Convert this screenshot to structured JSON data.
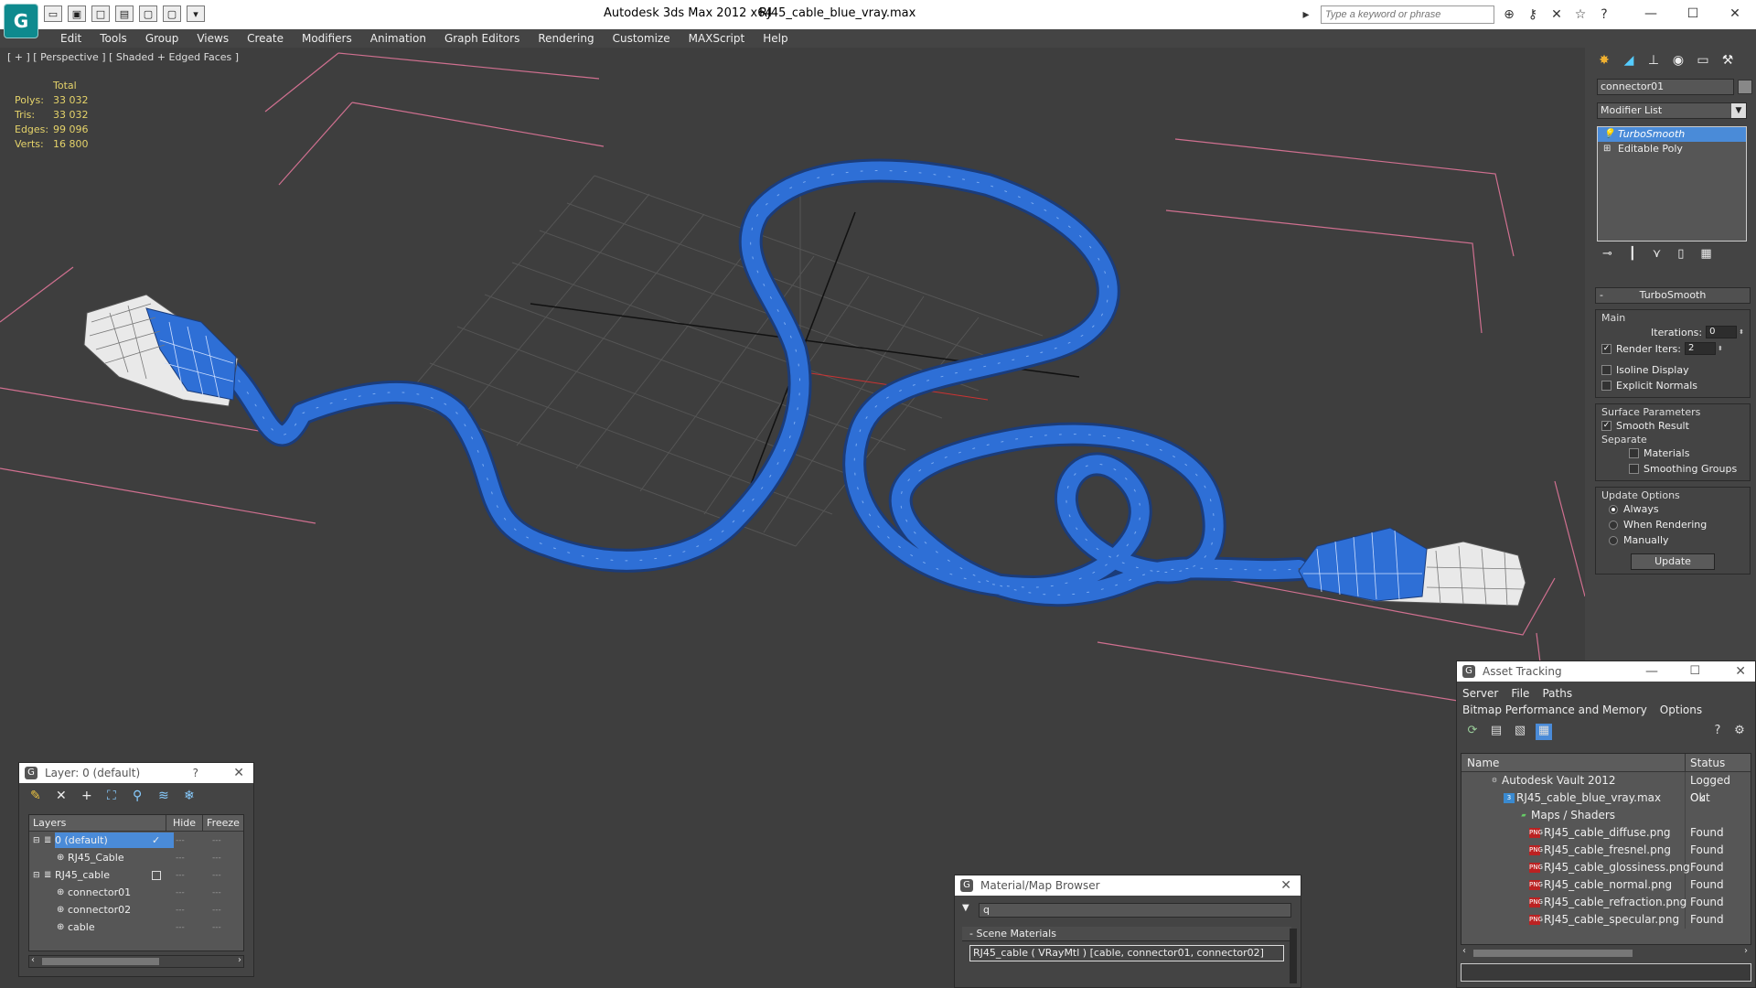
{
  "titlebar": {
    "app_title": "Autodesk 3ds Max  2012 x64",
    "file_name": "RJ45_cable_blue_vray.max",
    "search_placeholder": "Type a keyword or phrase"
  },
  "menu": [
    "Edit",
    "Tools",
    "Group",
    "Views",
    "Create",
    "Modifiers",
    "Animation",
    "Graph Editors",
    "Rendering",
    "Customize",
    "MAXScript",
    "Help"
  ],
  "viewport": {
    "label": "[ + ] [ Perspective ] [ Shaded + Edged Faces ]",
    "stats": {
      "header": "Total",
      "rows": [
        {
          "k": "Polys:",
          "v": "33 032"
        },
        {
          "k": "Tris:",
          "v": "33 032"
        },
        {
          "k": "Edges:",
          "v": "99 096"
        },
        {
          "k": "Verts:",
          "v": "16 800"
        }
      ]
    },
    "cable_color": "#2e6fd6"
  },
  "command_panel": {
    "object_name": "connector01",
    "modifier_list_label": "Modifier List",
    "stack": [
      {
        "label": "TurboSmooth",
        "selected": true
      },
      {
        "label": "Editable Poly",
        "selected": false
      }
    ],
    "rollout_title": "TurboSmooth",
    "main_group": "Main",
    "iterations_label": "Iterations:",
    "iterations_value": "0",
    "render_iters_label": "Render Iters:",
    "render_iters_value": "2",
    "isoline_label": "Isoline Display",
    "explicit_normals_label": "Explicit Normals",
    "surface_group": "Surface Parameters",
    "smooth_result_label": "Smooth Result",
    "separate_label": "Separate",
    "materials_label": "Materials",
    "smoothing_groups_label": "Smoothing Groups",
    "update_group": "Update Options",
    "always_label": "Always",
    "when_rendering_label": "When Rendering",
    "manually_label": "Manually",
    "update_button": "Update"
  },
  "layer_window": {
    "title": "Layer: 0 (default)",
    "help": "?",
    "col_layers": "Layers",
    "col_hide": "Hide",
    "col_freeze": "Freeze",
    "rows": [
      {
        "label": "0 (default)",
        "indent": 0,
        "selected": true
      },
      {
        "label": "RJ45_Cable",
        "indent": 1,
        "selected": false
      },
      {
        "label": "RJ45_cable",
        "indent": 0,
        "selected": false
      },
      {
        "label": "connector01",
        "indent": 1,
        "selected": false
      },
      {
        "label": "connector02",
        "indent": 1,
        "selected": false
      },
      {
        "label": "cable",
        "indent": 1,
        "selected": false
      }
    ]
  },
  "material_browser": {
    "title": "Material/Map Browser",
    "search_value": "q",
    "group_label": "Scene Materials",
    "item": "RJ45_cable  ( VRayMtl )  [cable, connector01, connector02]"
  },
  "asset_tracking": {
    "title": "Asset Tracking",
    "menu1": [
      "Server",
      "File",
      "Paths"
    ],
    "menu2": [
      "Bitmap Performance and Memory",
      "Options"
    ],
    "col_name": "Name",
    "col_status": "Status",
    "rows": [
      {
        "name": "Autodesk Vault 2012",
        "status": "Logged Out",
        "indent": 30,
        "icon": "vault"
      },
      {
        "name": "RJ45_cable_blue_vray.max",
        "status": "Ok",
        "indent": 46,
        "icon": "max"
      },
      {
        "name": "Maps / Shaders",
        "status": "",
        "indent": 62,
        "icon": "folder"
      },
      {
        "name": "RJ45_cable_diffuse.png",
        "status": "Found",
        "indent": 74,
        "icon": "png"
      },
      {
        "name": "RJ45_cable_fresnel.png",
        "status": "Found",
        "indent": 74,
        "icon": "png"
      },
      {
        "name": "RJ45_cable_glossiness.png",
        "status": "Found",
        "indent": 74,
        "icon": "png"
      },
      {
        "name": "RJ45_cable_normal.png",
        "status": "Found",
        "indent": 74,
        "icon": "png"
      },
      {
        "name": "RJ45_cable_refraction.png",
        "status": "Found",
        "indent": 74,
        "icon": "png"
      },
      {
        "name": "RJ45_cable_specular.png",
        "status": "Found",
        "indent": 74,
        "icon": "png"
      }
    ]
  }
}
